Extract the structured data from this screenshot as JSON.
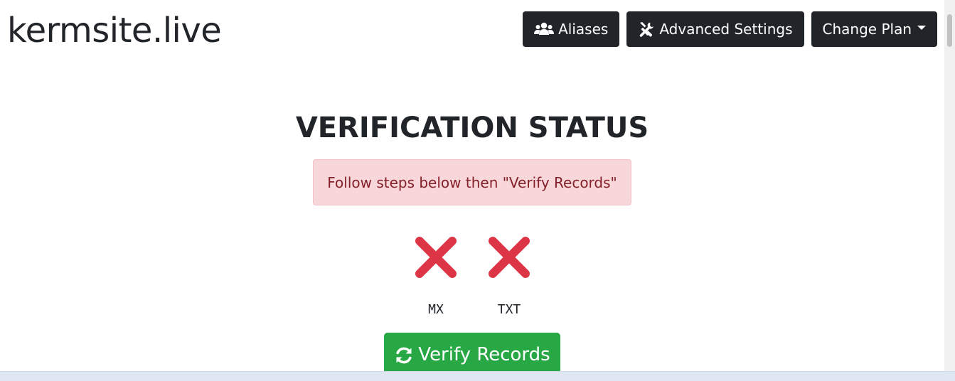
{
  "header": {
    "site_title": "kermsite.live",
    "buttons": {
      "aliases": {
        "label": "Aliases",
        "icon": "users-icon"
      },
      "advanced_settings": {
        "label": "Advanced Settings",
        "icon": "tools-icon"
      },
      "change_plan": {
        "label": "Change Plan",
        "icon": "caret-down-icon"
      }
    }
  },
  "main": {
    "heading": "VERIFICATION STATUS",
    "alert": {
      "text": "Follow steps below then \"Verify Records\"",
      "color": "#842029",
      "background": "#f8d7da"
    },
    "records": [
      {
        "label": "MX",
        "status": "failed",
        "icon": "x-mark-icon",
        "color": "#dc3545"
      },
      {
        "label": "TXT",
        "status": "failed",
        "icon": "x-mark-icon",
        "color": "#dc3545"
      }
    ],
    "verify_button": {
      "label": "Verify Records",
      "icon": "sync-icon",
      "color": "#28a745"
    }
  },
  "colors": {
    "dark_button": "#212529",
    "success": "#28a745",
    "danger": "#dc3545"
  }
}
